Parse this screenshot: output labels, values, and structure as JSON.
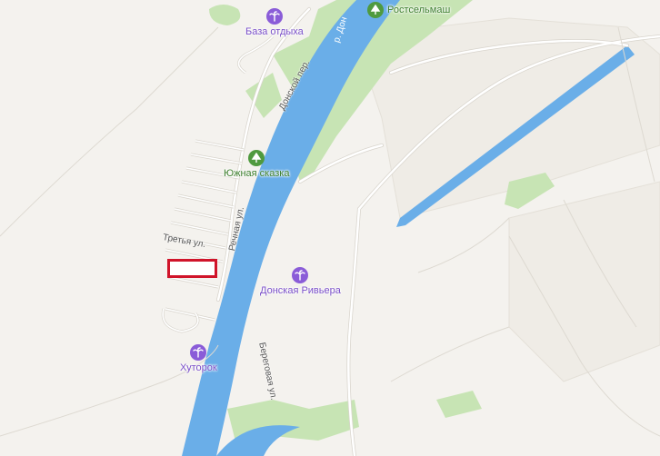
{
  "map": {
    "colors": {
      "land": "#f4f2ee",
      "water": "#6aaee8",
      "forest": "#c7e4b4",
      "road": "#ffffff",
      "road_outline": "#d8d4cc",
      "marker": "#d0142a"
    },
    "labels": {
      "river": "р. Дон",
      "street_donskoy": "Донской пер.",
      "street_rechnaya": "Речная ул.",
      "street_tretya": "Третья ул.",
      "street_beregovaya": "Береговая ул."
    },
    "pois": [
      {
        "name": "База отдыха",
        "category": "recreation",
        "icon": "palm-icon",
        "color": "#8a5cd8"
      },
      {
        "name": "Ростсельмаш",
        "category": "park",
        "icon": "tree-icon",
        "color": "#4f9a3f"
      },
      {
        "name": "Южная сказка",
        "category": "park",
        "icon": "tree-icon",
        "color": "#4f9a3f"
      },
      {
        "name": "Донская Ривьера",
        "category": "recreation",
        "icon": "palm-icon",
        "color": "#8a5cd8"
      },
      {
        "name": "Хуторок",
        "category": "recreation",
        "icon": "palm-icon",
        "color": "#8a5cd8"
      }
    ]
  }
}
